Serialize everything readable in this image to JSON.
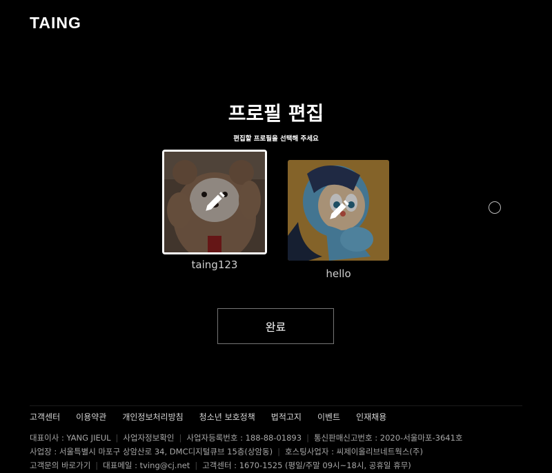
{
  "brand": {
    "logo_text": "TAING"
  },
  "header": {
    "title": "프로필 편집",
    "subtitle": "편집할 프로필을 선택해 주세요"
  },
  "profiles": [
    {
      "name": "taing123",
      "selected": true
    },
    {
      "name": "hello",
      "selected": false
    }
  ],
  "actions": {
    "done_label": "완료"
  },
  "footer": {
    "links": [
      "고객센터",
      "이용약관",
      "개인정보처리방침",
      "청소년 보호정책",
      "법적고지",
      "이벤트",
      "인재채용"
    ],
    "line1": [
      "대표이사 : YANG JIEUL",
      "사업자정보확인",
      "사업자등록번호 : 188-88-01893",
      "통신판매신고번호 : 2020-서울마포-3641호"
    ],
    "line2": [
      "사업장 : 서울특별시 마포구 상암산로 34, DMC디지털큐브 15층(상암동)",
      "호스팅사업자 : 씨제이올리브네트웍스(주)"
    ],
    "line3": [
      "고객문의 바로가기",
      "대표메일 : tving@cj.net",
      "고객센터 : 1670-1525 (평일/주말 09시~18시, 공휴일 휴무)"
    ]
  },
  "icons": {
    "edit": "pencil-icon",
    "add": "add-profile-icon"
  },
  "colors": {
    "background": "#000000",
    "text": "#ffffff",
    "selected_border": "#ffffff"
  }
}
